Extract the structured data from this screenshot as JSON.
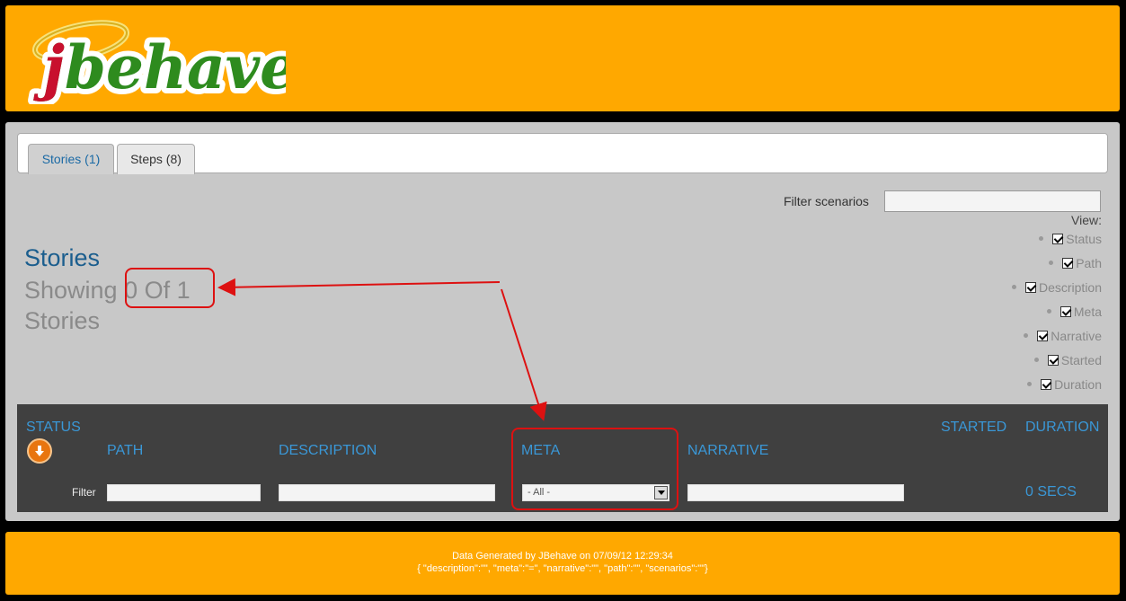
{
  "brand": {
    "logo_text": "jbehave"
  },
  "tabs": [
    {
      "label": "Stories (1)",
      "active": true
    },
    {
      "label": "Steps (8)",
      "active": false
    }
  ],
  "filter": {
    "label": "Filter scenarios",
    "value": ""
  },
  "view": {
    "label": "View:",
    "options": [
      {
        "label": "Status",
        "checked": true
      },
      {
        "label": "Path",
        "checked": true
      },
      {
        "label": "Description",
        "checked": true
      },
      {
        "label": "Meta",
        "checked": true
      },
      {
        "label": "Narrative",
        "checked": true
      },
      {
        "label": "Started",
        "checked": true
      },
      {
        "label": "Duration",
        "checked": true
      }
    ]
  },
  "stories": {
    "title": "Stories",
    "showing_prefix": "Showing",
    "showing_count": "0 Of 1",
    "showing_suffix": "Stories"
  },
  "table": {
    "headers": {
      "status": "STATUS",
      "path": "PATH",
      "description": "DESCRIPTION",
      "meta": "META",
      "narrative": "NARRATIVE",
      "started": "STARTED",
      "duration": "DURATION"
    },
    "filter_label": "Filter",
    "meta_select": "- All -",
    "duration_value": "0 SECS"
  },
  "footer": {
    "generated": "Data Generated by JBehave on 07/09/12 12:29:34",
    "json": "{ \"description\":\"\", \"meta\":\"=\", \"narrative\":\"\", \"path\":\"\", \"scenarios\":\"\"}"
  },
  "colors": {
    "orange": "#ffa800",
    "panel": "#c8c8c8",
    "table_bg": "#404040",
    "link_blue": "#3a97d6",
    "annotation_red": "#d11111"
  },
  "icons": {
    "status_sort": "arrow-down-circle-icon",
    "checkbox": "checkbox-checked-icon"
  }
}
